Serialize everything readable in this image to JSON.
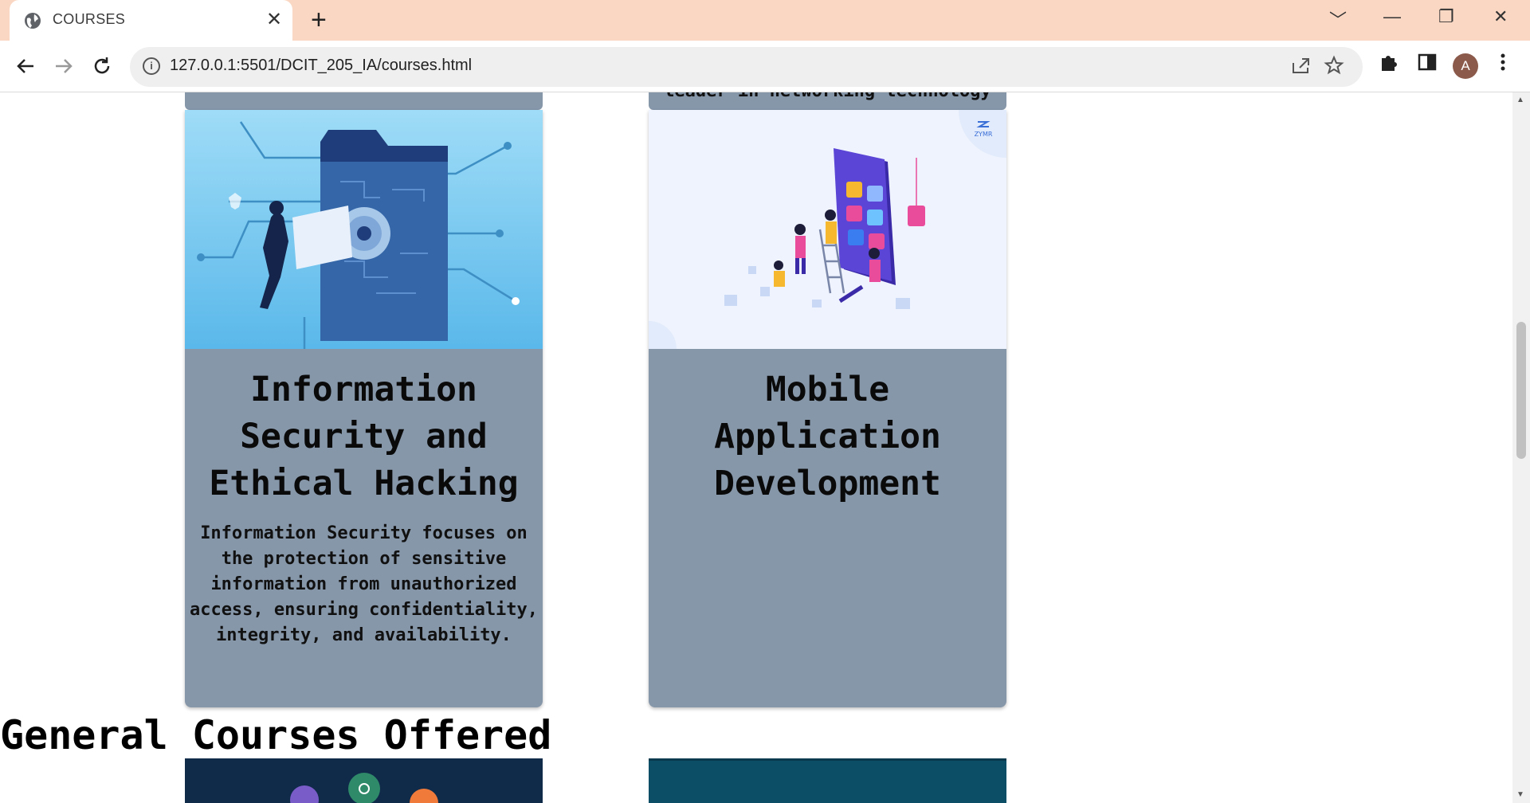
{
  "browser": {
    "tab_title": "COURSES",
    "tab_close": "✕",
    "new_tab": "+",
    "url": "127.0.0.1:5501/DCIT_205_IA/courses.html",
    "avatar_letter": "A",
    "window_controls": [
      "﹀",
      "—",
      "❐",
      "✕"
    ]
  },
  "page": {
    "top_stub_right_text": "leader in networking\ntechnology",
    "cards": [
      {
        "title": "Information Security and Ethical Hacking",
        "description": "Information Security focuses on the protection of sensitive information from unauthorized access, ensuring confidentiality, integrity, and availability.",
        "image_icon": "security-illustration"
      },
      {
        "title": "Mobile Application Development",
        "description": "",
        "image_icon": "mobile-app-illustration",
        "image_logo_text": "ZYMR"
      }
    ],
    "section_heading": "General Courses Offered"
  },
  "colors": {
    "card_bg": "#8797aa",
    "tab_strip": "#fad7c3"
  }
}
